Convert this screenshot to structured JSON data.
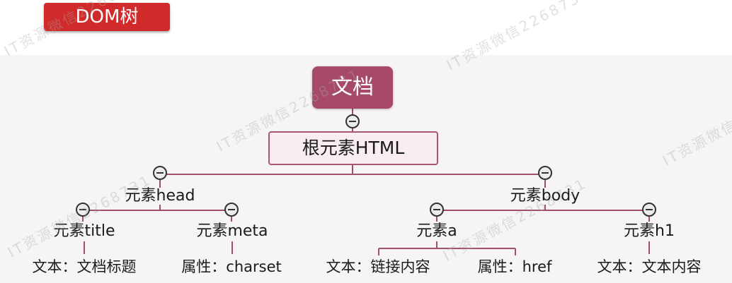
{
  "header": {
    "title": "DOM树"
  },
  "tree": {
    "root": "文档",
    "html": "根元素HTML",
    "head": {
      "label": "元素head",
      "title": {
        "label": "元素title",
        "leaf": "文本：文档标题"
      },
      "meta": {
        "label": "元素meta",
        "leaf": "属性：charset"
      }
    },
    "body": {
      "label": "元素body",
      "a": {
        "label": "元素a",
        "leaves": [
          "文本：链接内容",
          "属性：href"
        ]
      },
      "h1": {
        "label": "元素h1",
        "leaf": "文本：文本内容"
      }
    }
  },
  "watermark": {
    "text": "IT资源微信2268731"
  },
  "colors": {
    "badge": "#d12a2a",
    "root": "#a74a67",
    "html_border": "#a9576f",
    "line": "#a0506a"
  }
}
